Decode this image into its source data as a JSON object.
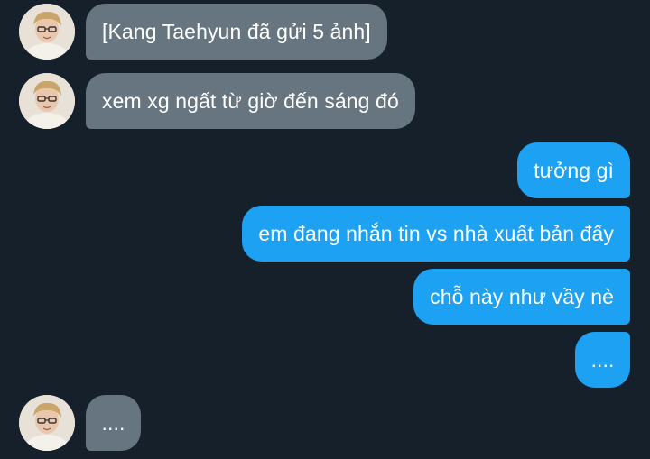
{
  "conversation": {
    "messages": [
      {
        "direction": "incoming",
        "text": "[Kang Taehyun đã gửi 5 ảnh]"
      },
      {
        "direction": "incoming",
        "text": "xem xg ngất từ giờ đến sáng đó"
      },
      {
        "direction": "outgoing",
        "text": "tưởng gì"
      },
      {
        "direction": "outgoing",
        "text": "em đang nhắn tin vs nhà xuất bản đấy"
      },
      {
        "direction": "outgoing",
        "text": "chỗ này như vầy nè"
      },
      {
        "direction": "outgoing",
        "text": "...."
      },
      {
        "direction": "incoming",
        "text": "...."
      }
    ]
  },
  "colors": {
    "background": "#15202b",
    "incoming_bubble": "#66757f",
    "outgoing_bubble": "#1da1f2",
    "text": "#ffffff"
  },
  "icons": {
    "sender_avatar": "user-avatar-photo"
  }
}
